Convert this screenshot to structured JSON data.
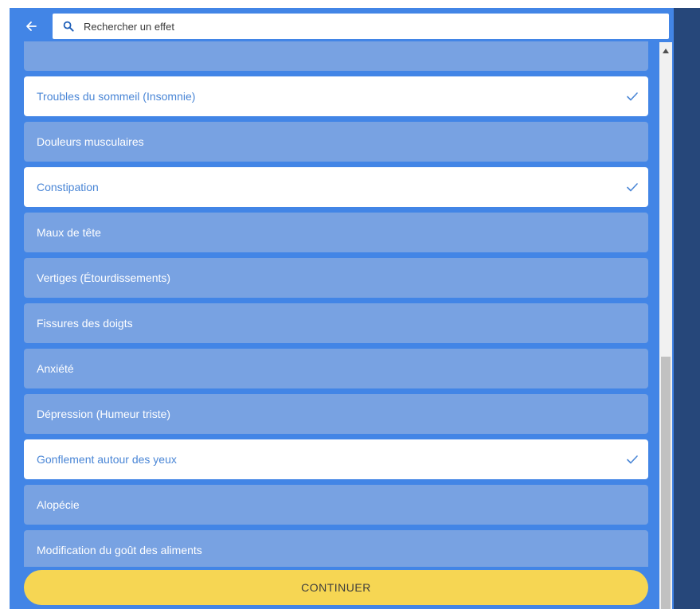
{
  "header": {
    "back_icon": "arrow-left-icon",
    "search_icon": "search-icon",
    "search_placeholder": "Rechercher un effet",
    "search_value": ""
  },
  "list": {
    "items": [
      {
        "label": "",
        "selected": false
      },
      {
        "label": "Troubles du sommeil (Insomnie)",
        "selected": true
      },
      {
        "label": "Douleurs musculaires",
        "selected": false
      },
      {
        "label": "Constipation",
        "selected": true
      },
      {
        "label": "Maux de tête",
        "selected": false
      },
      {
        "label": "Vertiges (Étourdissements)",
        "selected": false
      },
      {
        "label": "Fissures des doigts",
        "selected": false
      },
      {
        "label": "Anxiété",
        "selected": false
      },
      {
        "label": "Dépression (Humeur triste)",
        "selected": false
      },
      {
        "label": "Gonflement autour des yeux",
        "selected": true
      },
      {
        "label": "Alopécie",
        "selected": false
      },
      {
        "label": "Modification du goût des aliments",
        "selected": false
      }
    ],
    "check_icon": "checkmark-icon"
  },
  "footer": {
    "continue_label": "CONTINUER"
  },
  "colors": {
    "app_background": "#4285e6",
    "item_unselected": "#78a2e2",
    "item_selected": "#ffffff",
    "selected_text": "#4a86d6",
    "continue_button": "#f6d653",
    "right_strip": "#26477a"
  }
}
